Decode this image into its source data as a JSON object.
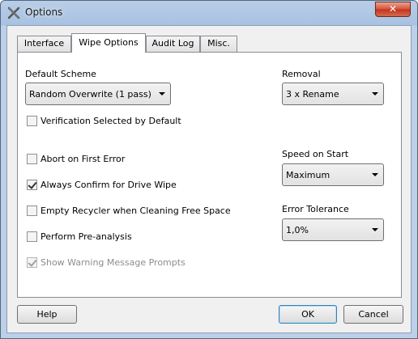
{
  "window": {
    "title": "Options",
    "close_label": "✕",
    "icon": "eraser-x-icon"
  },
  "tabs": [
    {
      "label": "Interface",
      "active": false
    },
    {
      "label": "Wipe Options",
      "active": true
    },
    {
      "label": "Audit Log",
      "active": false
    },
    {
      "label": "Misc.",
      "active": false
    }
  ],
  "wipe": {
    "default_scheme_label": "Default Scheme",
    "default_scheme_value": "Random Overwrite (1 pass)",
    "removal_label": "Removal",
    "removal_value": "3 x Rename",
    "verification_label": "Verification Selected by Default",
    "verification_checked": false,
    "abort_label": "Abort on First Error",
    "abort_checked": false,
    "confirm_label": "Always Confirm for Drive Wipe",
    "confirm_checked": true,
    "recycler_label": "Empty Recycler when Cleaning Free Space",
    "recycler_checked": false,
    "preanalysis_label": "Perform Pre-analysis",
    "preanalysis_checked": false,
    "warning_label": "Show Warning Message Prompts",
    "warning_checked": true,
    "warning_enabled": false,
    "speed_label": "Speed on Start",
    "speed_value": "Maximum",
    "tolerance_label": "Error Tolerance",
    "tolerance_value": "1,0%"
  },
  "buttons": {
    "help": "Help",
    "ok": "OK",
    "cancel": "Cancel"
  }
}
